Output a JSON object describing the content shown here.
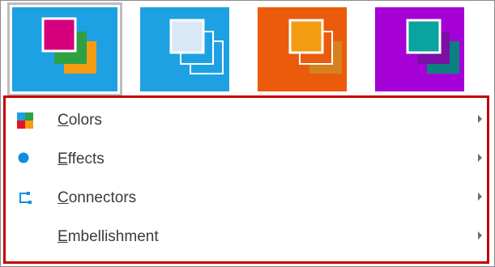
{
  "themes": [
    {
      "name": "theme-pink-green-orange",
      "bg": "#1ea1e3",
      "front": "#d6007e",
      "mid": "#2ea043",
      "back": "#f39c12",
      "selected": true
    },
    {
      "name": "theme-blue",
      "bg": "#1ea1e3",
      "front": "#d9e8f7",
      "mid": "#1ea1e3",
      "back": "#1ea1e3",
      "selected": false
    },
    {
      "name": "theme-orange",
      "bg": "#ea5b0c",
      "front": "#f39c12",
      "mid": "#ea5b0c",
      "back": "#d6801e",
      "selected": false
    },
    {
      "name": "theme-purple",
      "bg": "#a500d6",
      "front": "#0aa3a0",
      "mid": "#7b0fa6",
      "back": "#0a8080",
      "selected": false
    }
  ],
  "menu": {
    "items": [
      {
        "label": "Colors",
        "accesskey": "C",
        "rest": "olors",
        "icon": "colors-grid-icon"
      },
      {
        "label": "Effects",
        "accesskey": "E",
        "rest": "ffects",
        "icon": "effects-dot-icon"
      },
      {
        "label": "Connectors",
        "accesskey": "C",
        "rest": "onnectors",
        "icon": "connectors-icon"
      },
      {
        "label": "Embellishment",
        "accesskey": "E",
        "rest": "mbellishment",
        "icon": ""
      }
    ]
  },
  "colors": {
    "highlight_border": "#c00000",
    "selected_outline": "#bdbdbd"
  }
}
